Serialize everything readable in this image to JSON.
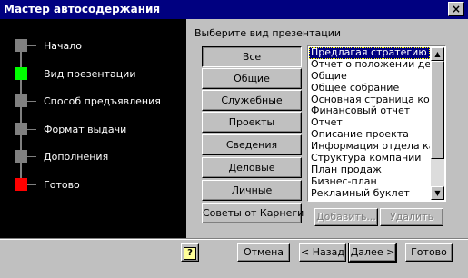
{
  "window": {
    "title": "Мастер автосодержания",
    "close_glyph": "×"
  },
  "steps": [
    {
      "label": "Начало",
      "state": "normal"
    },
    {
      "label": "Вид презентации",
      "state": "active"
    },
    {
      "label": "Способ предъявления",
      "state": "normal"
    },
    {
      "label": "Формат выдачи",
      "state": "normal"
    },
    {
      "label": "Дополнения",
      "state": "normal"
    },
    {
      "label": "Готово",
      "state": "final"
    }
  ],
  "colors": {
    "active_step": "#00ff00",
    "final_step": "#ff0000",
    "step": "#808080",
    "selection": "#000080"
  },
  "prompt": "Выберите вид презентации",
  "categories": [
    "Все",
    "Общие",
    "Служебные",
    "Проекты",
    "Сведения",
    "Деловые",
    "Личные",
    "Советы от Карнеги"
  ],
  "selected_category": "Все",
  "list": {
    "items": [
      "Предлагая стратегию",
      "Отчет о положении дел",
      "Общие",
      "Общее собрание",
      "Основная страница компании",
      "Финансовый отчет",
      "Отчет",
      "Описание проекта",
      "Информация отдела кадров",
      "Структура компании",
      "План продаж",
      "Бизнес-план",
      "Рекламный буклет"
    ],
    "selected_index": 0,
    "scroll_up_glyph": "▲",
    "scroll_down_glyph": "▼"
  },
  "list_buttons": {
    "add": "Добавить...",
    "remove": "Удалить"
  },
  "footer": {
    "help_glyph": "?",
    "cancel": "Отмена",
    "back": "< Назад",
    "next": "Далее >",
    "finish": "Готово"
  }
}
